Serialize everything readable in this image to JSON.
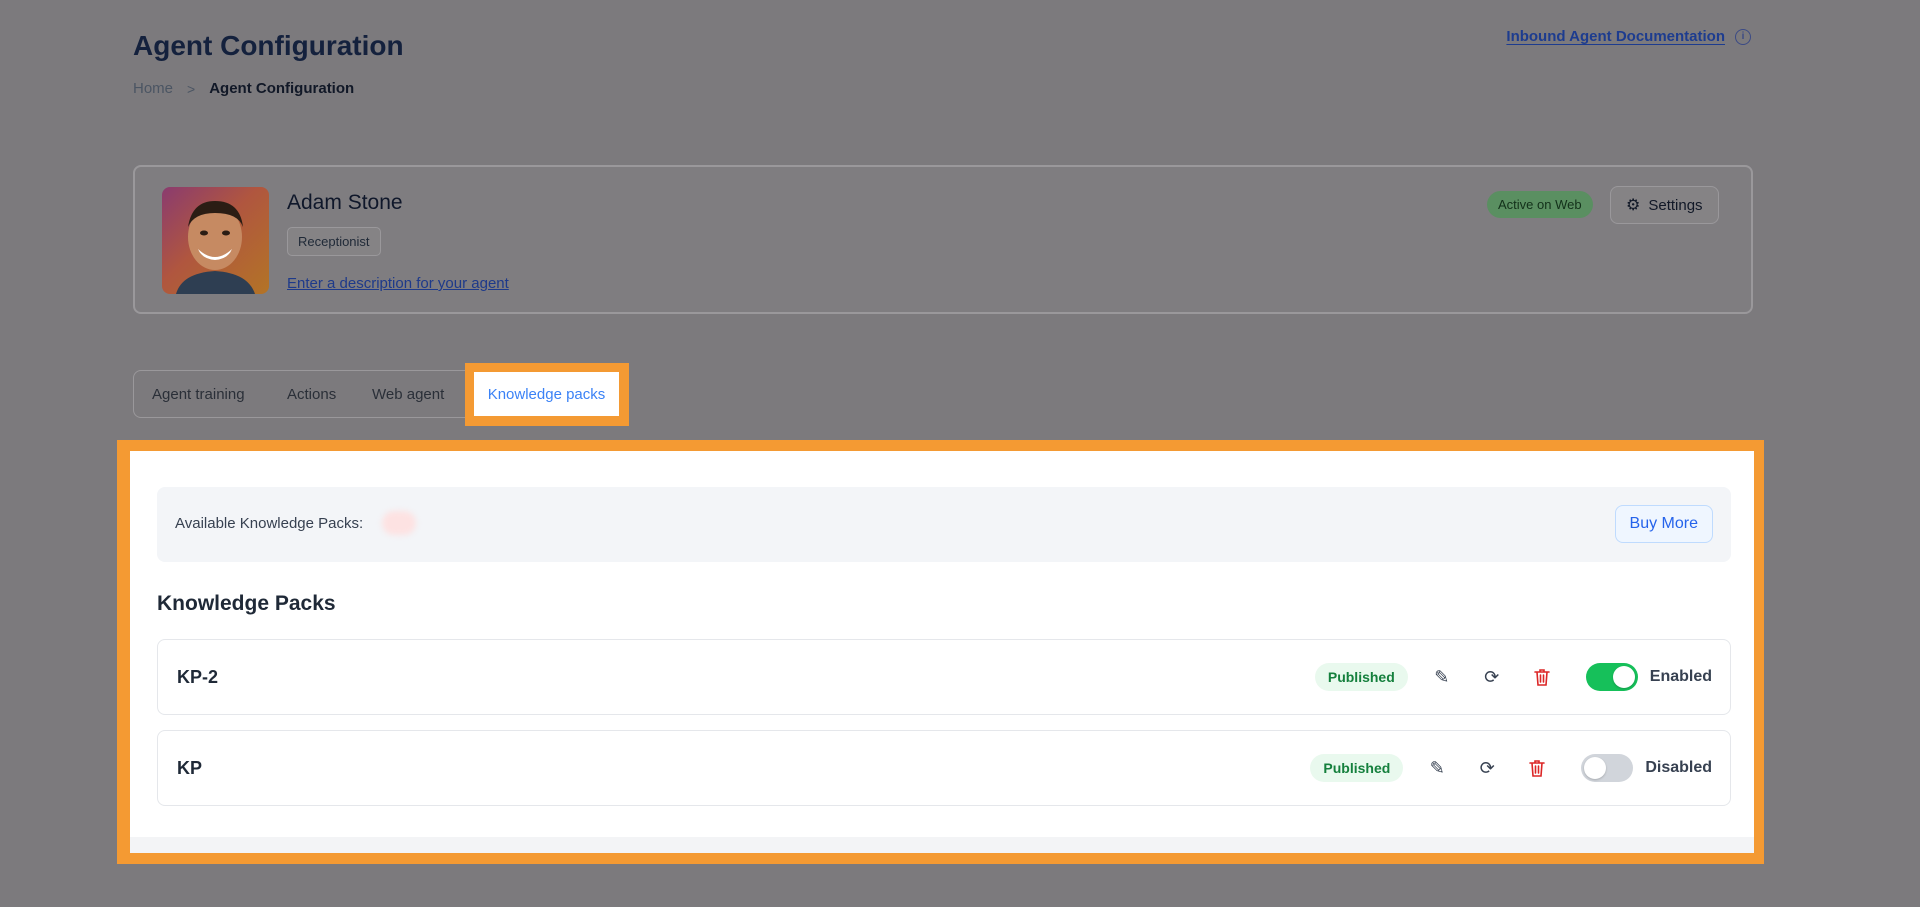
{
  "header": {
    "title": "Agent Configuration",
    "breadcrumb": {
      "home": "Home",
      "separator": ">",
      "current": "Agent Configuration"
    },
    "doc_link": "Inbound Agent Documentation",
    "info_glyph": "i"
  },
  "agent": {
    "name": "Adam Stone",
    "role": "Receptionist",
    "description_link": "Enter a description for your agent",
    "status": "Active on Web",
    "settings_label": "Settings"
  },
  "tabs": [
    {
      "label": "Agent training"
    },
    {
      "label": "Actions"
    },
    {
      "label": "Web agent"
    },
    {
      "label": "Knowledge packs",
      "active": true
    }
  ],
  "knowledge": {
    "available_label": "Available Knowledge Packs:",
    "buy_more": "Buy More",
    "heading": "Knowledge Packs",
    "packs": [
      {
        "name": "KP-2",
        "status": "Published",
        "enabled": true,
        "toggle_label": "Enabled"
      },
      {
        "name": "KP",
        "status": "Published",
        "enabled": false,
        "toggle_label": "Disabled"
      }
    ]
  },
  "colors": {
    "highlight": "#f49a33",
    "accent_blue": "#3b82f6",
    "toggle_on": "#16c05a",
    "published_green": "#15803d",
    "danger_red": "#dc2626"
  }
}
